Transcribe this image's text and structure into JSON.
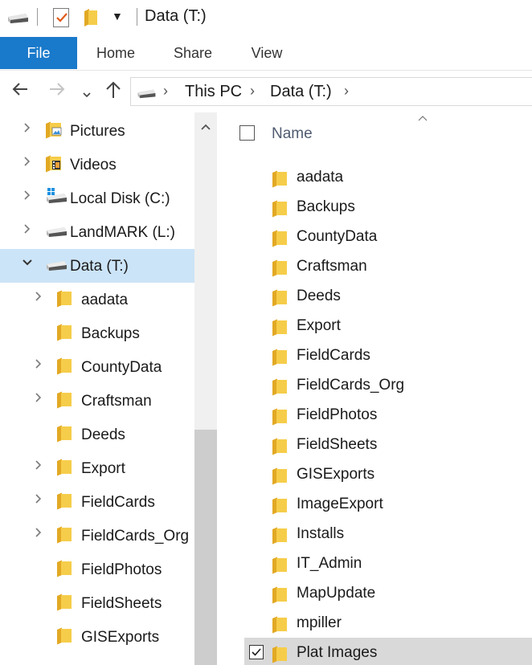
{
  "window": {
    "title": "Data (T:)"
  },
  "ribbon": {
    "tabs": [
      {
        "label": "File",
        "active": true
      },
      {
        "label": "Home"
      },
      {
        "label": "Share"
      },
      {
        "label": "View"
      }
    ]
  },
  "address": {
    "icon": "drive-icon",
    "segments": [
      "This PC",
      "Data (T:)"
    ]
  },
  "navpane": {
    "items": [
      {
        "label": "Pictures",
        "icon": "pictures-icon",
        "level": 0,
        "expandable": true
      },
      {
        "label": "Videos",
        "icon": "videos-icon",
        "level": 0,
        "expandable": true
      },
      {
        "label": "Local Disk (C:)",
        "icon": "windows-drive-icon",
        "level": 0,
        "expandable": true
      },
      {
        "label": "LandMARK (L:)",
        "icon": "drive-icon",
        "level": 0,
        "expandable": true
      },
      {
        "label": "Data (T:)",
        "icon": "drive-icon",
        "level": 0,
        "expanded": true,
        "selected": true
      },
      {
        "label": "aadata",
        "icon": "folder-icon",
        "level": 1,
        "expandable": true
      },
      {
        "label": "Backups",
        "icon": "folder-icon",
        "level": 1,
        "expandable": false
      },
      {
        "label": "CountyData",
        "icon": "folder-icon",
        "level": 1,
        "expandable": true
      },
      {
        "label": "Craftsman",
        "icon": "folder-icon",
        "level": 1,
        "expandable": true
      },
      {
        "label": "Deeds",
        "icon": "folder-icon",
        "level": 1,
        "expandable": false
      },
      {
        "label": "Export",
        "icon": "folder-icon",
        "level": 1,
        "expandable": true
      },
      {
        "label": "FieldCards",
        "icon": "folder-icon",
        "level": 1,
        "expandable": true
      },
      {
        "label": "FieldCards_Org",
        "icon": "folder-icon",
        "level": 1,
        "expandable": true
      },
      {
        "label": "FieldPhotos",
        "icon": "folder-icon",
        "level": 1,
        "expandable": false
      },
      {
        "label": "FieldSheets",
        "icon": "folder-icon",
        "level": 1,
        "expandable": false
      },
      {
        "label": "GISExports",
        "icon": "folder-icon",
        "level": 1,
        "expandable": false
      }
    ]
  },
  "filelist": {
    "columns": [
      "Name"
    ],
    "sort": "ascending",
    "items": [
      {
        "name": "aadata"
      },
      {
        "name": "Backups"
      },
      {
        "name": "CountyData"
      },
      {
        "name": "Craftsman"
      },
      {
        "name": "Deeds"
      },
      {
        "name": "Export"
      },
      {
        "name": "FieldCards"
      },
      {
        "name": "FieldCards_Org"
      },
      {
        "name": "FieldPhotos"
      },
      {
        "name": "FieldSheets"
      },
      {
        "name": "GISExports"
      },
      {
        "name": "ImageExport"
      },
      {
        "name": "Installs"
      },
      {
        "name": "IT_Admin"
      },
      {
        "name": "MapUpdate"
      },
      {
        "name": "mpiller"
      },
      {
        "name": "Plat Images",
        "selected": true,
        "checked": true
      }
    ]
  },
  "colors": {
    "accent": "#1979ca",
    "selection": "#cce4f7",
    "folder": "#f3c13a"
  }
}
